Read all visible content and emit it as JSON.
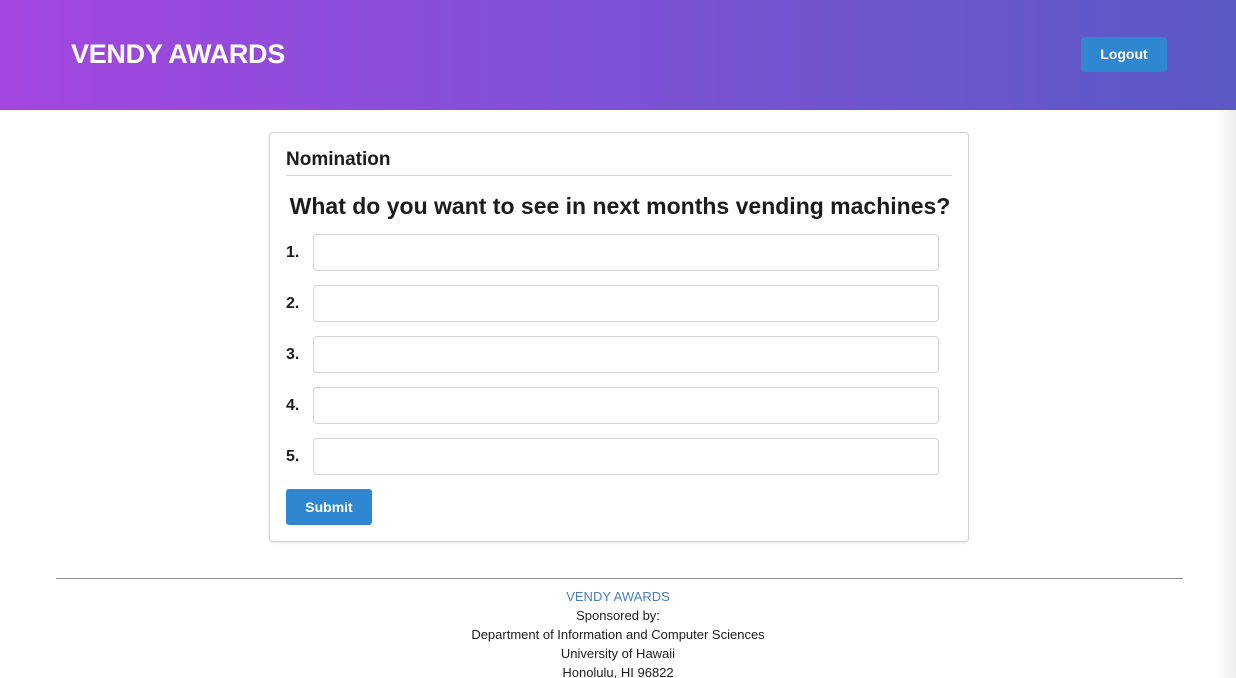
{
  "header": {
    "brand": "VENDY AWARDS",
    "logout_label": "Logout",
    "gradient_start": "#a346de",
    "gradient_end": "#5a59c6",
    "button_color": "#2f86d1"
  },
  "nomination": {
    "title": "Nomination",
    "question": "What do you want to see in next months vending machines?",
    "rows": [
      {
        "label": "1.",
        "value": ""
      },
      {
        "label": "2.",
        "value": ""
      },
      {
        "label": "3.",
        "value": ""
      },
      {
        "label": "4.",
        "value": ""
      },
      {
        "label": "5.",
        "value": ""
      }
    ],
    "submit_label": "Submit"
  },
  "footer": {
    "brand": "VENDY AWARDS",
    "sponsored": "Sponsored by:",
    "department": "Department of Information and Computer Sciences",
    "university": "University of Hawaii",
    "address": "Honolulu, HI 96822",
    "link_color": "#4a7dbf"
  }
}
